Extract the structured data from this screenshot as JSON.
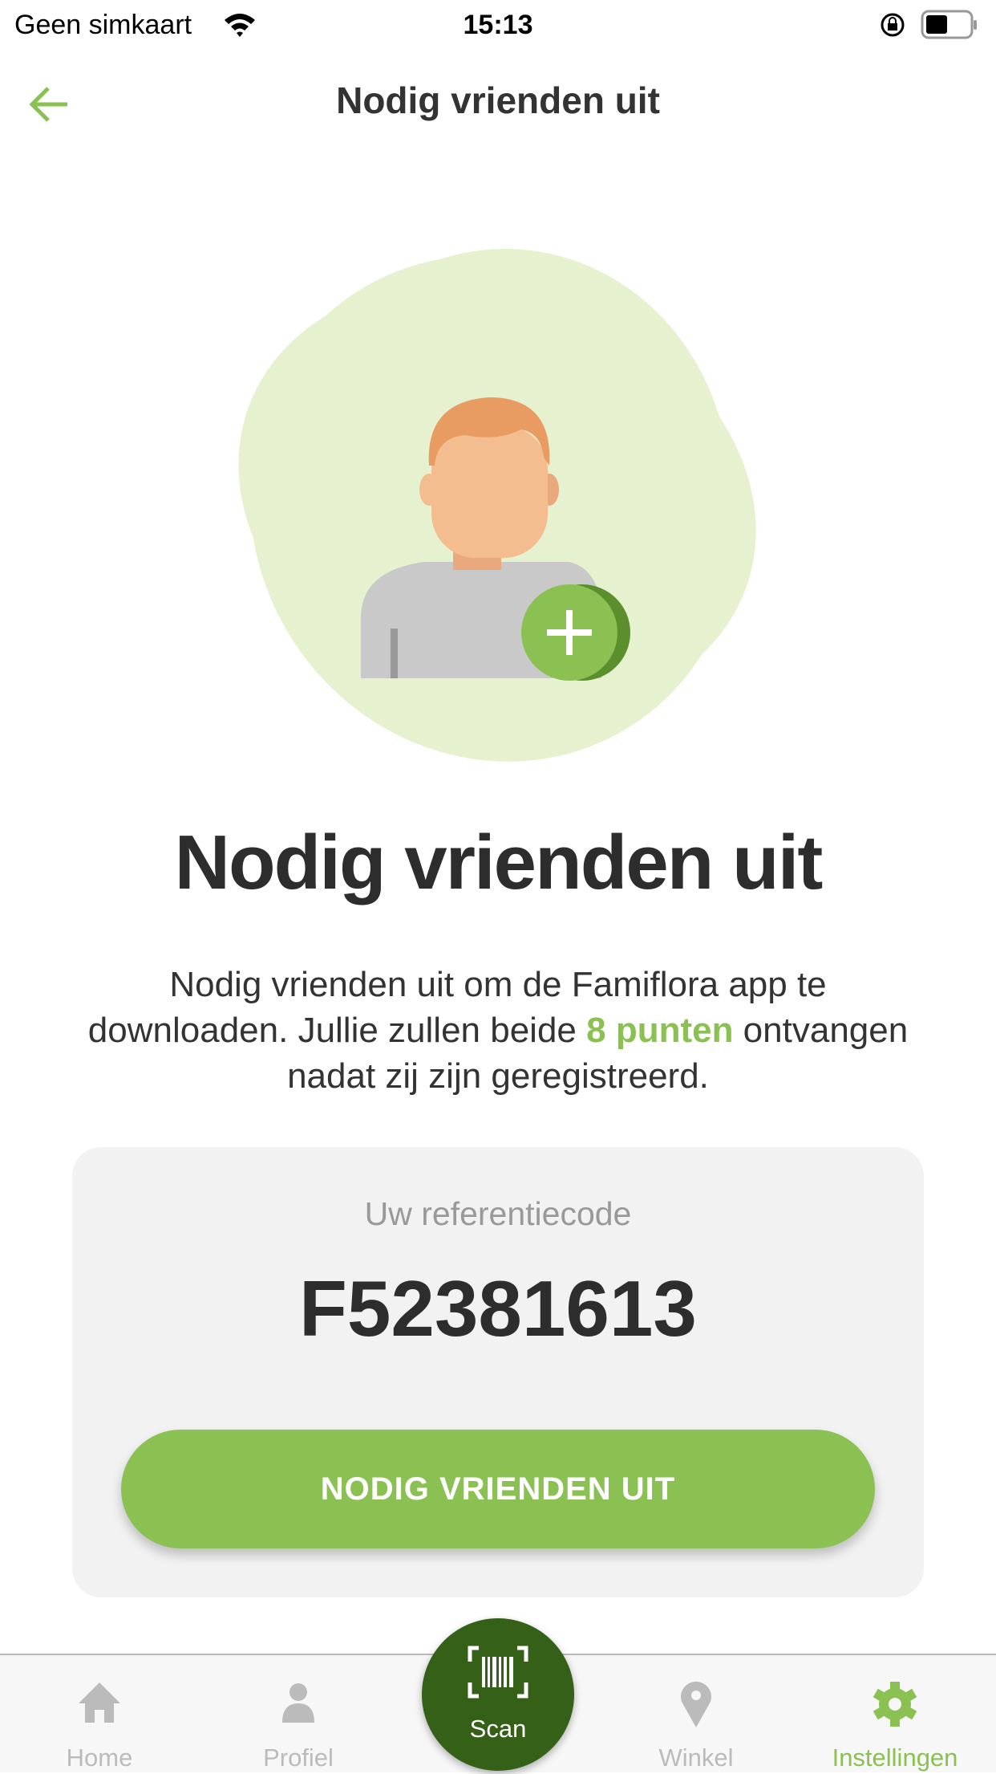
{
  "status_bar": {
    "carrier": "Geen simkaart",
    "time": "15:13"
  },
  "header": {
    "title": "Nodig vrienden uit"
  },
  "main": {
    "heading": "Nodig vrienden uit",
    "description_before": "Nodig vrienden uit om de Famiflora app te downloaden. Jullie zullen beide ",
    "description_highlight": "8 punten",
    "description_after": " ontvangen nadat zij zijn geregistreerd.",
    "referral_label": "Uw referentiecode",
    "referral_code": "F52381613",
    "invite_button": "NODIG VRIENDEN UIT"
  },
  "tabbar": {
    "items": [
      {
        "label": "Home",
        "icon": "home-icon"
      },
      {
        "label": "Profiel",
        "icon": "person-icon"
      },
      {
        "label": "Scan",
        "icon": "barcode-scan-icon"
      },
      {
        "label": "Winkel",
        "icon": "map-pin-icon"
      },
      {
        "label": "Instellingen",
        "icon": "gear-icon",
        "active": true
      }
    ]
  },
  "colors": {
    "accent": "#8bc053",
    "scan": "#346018",
    "inactive": "#bbbbbb"
  }
}
